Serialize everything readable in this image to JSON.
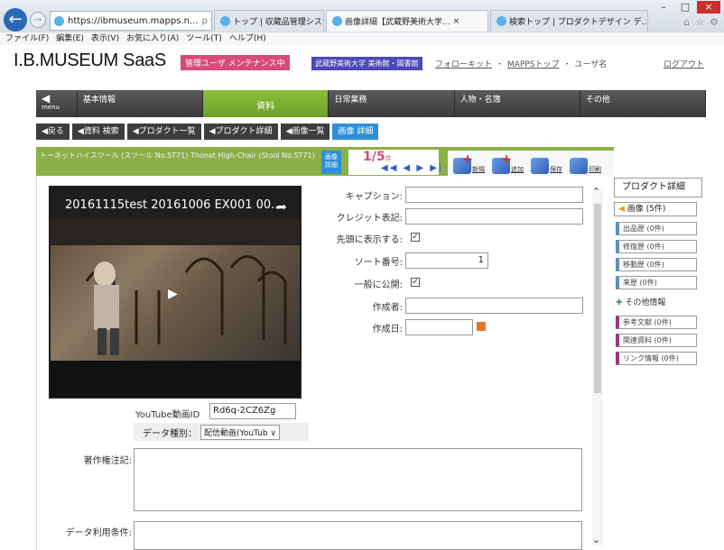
{
  "browser": {
    "address": "https://ibmuseum.mapps.n...",
    "address_icons": "ρ ▾ 🔒 C",
    "tabs": [
      {
        "label": "トップ | 収蔵品管理システム I.B...."
      },
      {
        "label": "画像詳細【武蔵野美術大学...",
        "close": "×"
      },
      {
        "label": "検索トップ | プロダクトデザイン デ..."
      }
    ],
    "window_controls": {
      "minimize": "–",
      "maximize": "□",
      "close": "×"
    },
    "menu": [
      "ファイル(F)",
      "編集(E)",
      "表示(V)",
      "お気に入り(A)",
      "ツール(T)",
      "ヘルプ(H)"
    ]
  },
  "header": {
    "logo": "I.B.MUSEUM SaaS",
    "maintenance_badge": "管理ユーザ メンテナンス中",
    "university_badge": "武蔵野美術大学 美術館・図書館",
    "links": [
      "フォローキット",
      "MAPPSトップ"
    ],
    "user": "ユーザ名",
    "logout": "ログアウト"
  },
  "nav": {
    "menu_label": "menu",
    "items": [
      "基本情報",
      "資料",
      "日常業務",
      "人物・名簿",
      "その他"
    ]
  },
  "breadcrumbs": [
    "◀戻る",
    "◀資料 検索",
    "◀プロダクト一覧",
    "◀プロダクト詳細",
    "◀画像一覧",
    "画像 詳細"
  ],
  "record": {
    "title": "トーネットハイスツール (スツール No.ST71)  Thonet High-Chair (Stool No.ST71)",
    "image_button": "画像 詳細",
    "page_current": "1/5",
    "page_unit": "件",
    "page_nav": "◀◀ ◀ ▶ ▶|"
  },
  "tools": [
    {
      "label": "新規"
    },
    {
      "label": "追加"
    },
    {
      "label": "保存"
    },
    {
      "label": "印刷"
    }
  ],
  "video": {
    "title": "20161115test 20161006 EX001 00...",
    "share_icon": "share-icon"
  },
  "form": {
    "youtube_id_label": "YouTube動画ID",
    "youtube_id_value": "Rd6q-2CZ6Zg",
    "data_type_label": "データ種別：",
    "data_type_value": "配信動画(YouTub ∨",
    "caption_label": "キャプション:",
    "credit_label": "クレジット表記:",
    "show_first_label": "先頭に表示する:",
    "sort_label": "ソート番号:",
    "sort_value": "1",
    "public_label": "一般に公開:",
    "creator_label": "作成者:",
    "created_label": "作成日:",
    "copyright_label": "著作権注記:",
    "usage_label": "データ利用条件:"
  },
  "sidebar": {
    "heading": "プロダクト詳細",
    "image_item": "画像 (5件)",
    "items": [
      {
        "label": "出品歴 (0件)",
        "color": "blue"
      },
      {
        "label": "修復歴 (0件)",
        "color": "blue"
      },
      {
        "label": "移動歴 (0件)",
        "color": "blue"
      },
      {
        "label": "来歴 (0件)",
        "color": "blue"
      },
      {
        "label": "参考文献 (0件)",
        "color": "purple"
      },
      {
        "label": "関連資料 (0件)",
        "color": "purple"
      },
      {
        "label": "リンク情報 (0件)",
        "color": "purple"
      }
    ],
    "other_info": "その他情報"
  }
}
